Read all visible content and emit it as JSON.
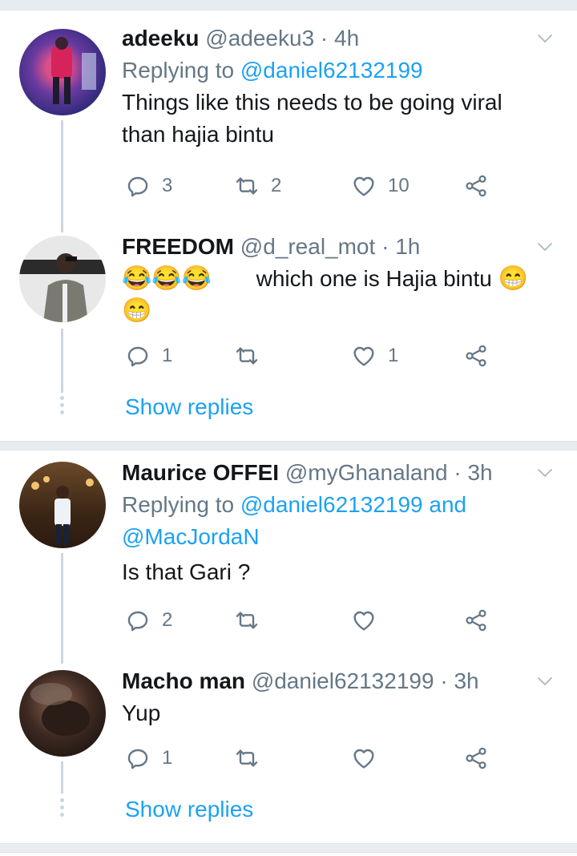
{
  "tweets": [
    {
      "name": "adeeku",
      "handle": "@adeeku3",
      "time": "4h",
      "reply_prefix": "Replying to",
      "reply_mentions": "@daniel62132199",
      "text_line1": "Things like this needs to be going viral",
      "text_line2": "than hajia bintu",
      "replies": "3",
      "retweets": "2",
      "likes": "10"
    },
    {
      "name": "FREEDOM",
      "handle": "@d_real_mot",
      "time": "1h",
      "emoji_start": "😂😂😂",
      "text": "which one is Hajia bintu",
      "emoji_end": "😁",
      "emoji_line2": "😁",
      "replies": "1",
      "retweets": "",
      "likes": "1",
      "show_replies": "Show replies"
    },
    {
      "name": "Maurice OFFEI",
      "handle": "@myGhanaland",
      "time": "3h",
      "reply_prefix": "Replying to",
      "reply_mentions_line1": "@daniel62132199 and",
      "reply_mentions_line2": "@MacJordaN",
      "text": "Is that Gari ?",
      "replies": "2",
      "retweets": "",
      "likes": ""
    },
    {
      "name": "Macho man",
      "handle": "@daniel62132199",
      "time": "3h",
      "text": "Yup",
      "replies": "1",
      "retweets": "",
      "likes": "",
      "show_replies": "Show replies"
    }
  ],
  "separator": "·",
  "colors": {
    "accent": "#1da1f2",
    "secondary_text": "#657786",
    "divider": "#e6ecf0"
  }
}
